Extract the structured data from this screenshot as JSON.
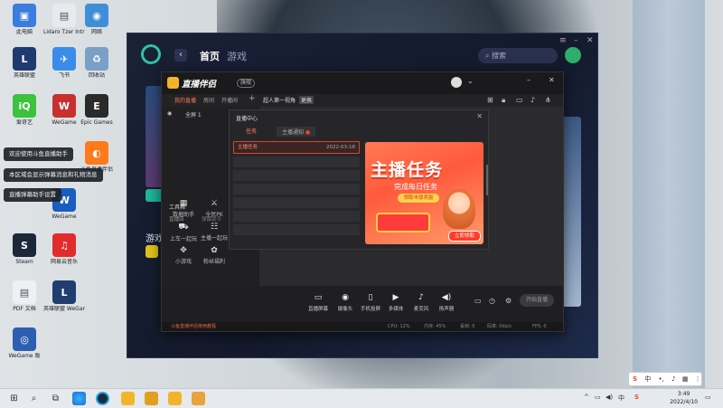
{
  "desktop": {
    "icons": [
      {
        "label": "此电脑",
        "glyph": "▣",
        "color": "#3b7ddd"
      },
      {
        "label": "Lidaro Tzer Intruder Fa...",
        "glyph": "▤",
        "color": "#e8eaee"
      },
      {
        "label": "网络",
        "glyph": "◉",
        "color": "#3f8fd8"
      },
      {
        "label": "英雄联盟",
        "glyph": "L",
        "color": "#1f3a6e"
      },
      {
        "label": "飞书",
        "glyph": "✈",
        "color": "#3b8ce8"
      },
      {
        "label": "回收站",
        "glyph": "♻",
        "color": "#7aa0c8"
      },
      {
        "label": "爱奇艺",
        "glyph": "iQ",
        "color": "#3cc23c"
      },
      {
        "label": "WeGame",
        "glyph": "W",
        "color": "#c8302e"
      },
      {
        "label": "Epic Games",
        "glyph": "E",
        "color": "#2a2a2a"
      },
      {
        "label": "斗鱼直播伴侣",
        "glyph": "◐",
        "color": "#ff7a1a"
      },
      {
        "label": "WeGame",
        "glyph": "W",
        "color": "#1a5dbf"
      },
      {
        "label": "Steam",
        "glyph": "S",
        "color": "#1b2838"
      },
      {
        "label": "网易云音乐",
        "glyph": "♫",
        "color": "#e22c2c"
      },
      {
        "label": "PDF 文档",
        "glyph": "▤",
        "color": "#eef0f3"
      },
      {
        "label": "英雄联盟 WeGame版",
        "glyph": "L",
        "color": "#203d70"
      },
      {
        "label": "WeGame 版",
        "glyph": "◎",
        "color": "#2c5fb2"
      }
    ],
    "notifications": [
      "欢迎使用斗鱼直播助手",
      "本区域会显示弹幕消息和礼物消息",
      "直播弹幕助手设置"
    ]
  },
  "launcher": {
    "tab_home": "首页",
    "tab_games": "游戏",
    "search_placeholder": "搜索",
    "section_label": "游戏"
  },
  "streamer": {
    "brand": "直播伴侣",
    "version": "旗舰",
    "tabs": [
      "我的直播",
      "房间",
      "开播间",
      "+",
      "超人第一视角",
      "更换"
    ],
    "scene": "全屏 1",
    "tools_title": "工具箱",
    "tools_sub": [
      "直播间",
      "弹幕助手"
    ],
    "tools": [
      {
        "label": "数据助手",
        "icon": "▦"
      },
      {
        "label": "全民PK",
        "icon": "⚔"
      },
      {
        "label": "上车一起玩",
        "icon": "⛟"
      },
      {
        "label": "主播一起玩",
        "icon": "☷"
      },
      {
        "label": "发奖助手",
        "icon": "⬡"
      },
      {
        "label": "小游戏",
        "icon": "✥"
      },
      {
        "label": "粉丝福利",
        "icon": "✿"
      }
    ],
    "bottom_tools": [
      {
        "label": "直播屏幕",
        "icon": "▭"
      },
      {
        "label": "摄像头",
        "icon": "◉"
      },
      {
        "label": "手机投屏",
        "icon": "▯"
      },
      {
        "label": "多媒体",
        "icon": "▶"
      },
      {
        "label": "麦克风",
        "icon": "♪"
      },
      {
        "label": "扬声器",
        "icon": "◀)"
      }
    ],
    "start_button": "开始直播",
    "status_left": "斗鱼直播伴侣使用教程",
    "status_items": [
      "CPU: 12%",
      "内存: 45%",
      "丢帧: 0",
      "码率: 0kb/s",
      "FPS: 0"
    ]
  },
  "anchor_center": {
    "title": "直播中心",
    "tabs": [
      "任务",
      "主播通知"
    ],
    "rows": [
      {
        "label": "主播任务",
        "date": "2022-03-18"
      }
    ],
    "banner": {
      "title": "主播任务",
      "subtitle": "完成每日任务",
      "pill": "领取丰厚奖励",
      "button": "立即领取"
    }
  },
  "taskbar": {
    "time": "3:49",
    "date": "2022/4/10",
    "ime_label": "中"
  }
}
